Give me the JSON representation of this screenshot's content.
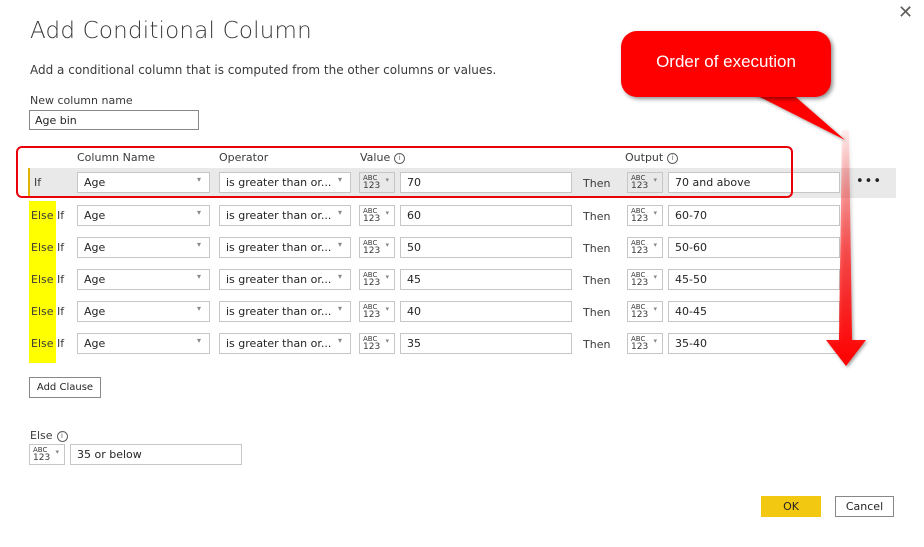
{
  "dialog": {
    "title": "Add Conditional Column",
    "subtitle": "Add a conditional column that is computed from the other columns or values.",
    "close_icon": "close-icon"
  },
  "new_column": {
    "label": "New column name",
    "value": "Age bin"
  },
  "headers": {
    "column_name": "Column Name",
    "operator": "Operator",
    "value": "Value",
    "output": "Output",
    "info_glyph": "i"
  },
  "type_icon": {
    "top": "ABC",
    "bottom": "123",
    "arrow": "▾"
  },
  "dropdown_arrow": "▾",
  "then_label": "Then",
  "more_glyph": "•••",
  "clauses": [
    {
      "prefix": "",
      "keyword": "If",
      "column": "Age",
      "operator": "is greater than or...",
      "value": "70",
      "output": "70 and above"
    },
    {
      "prefix": "Else",
      "keyword": " If",
      "column": "Age",
      "operator": "is greater than or...",
      "value": "60",
      "output": "60-70"
    },
    {
      "prefix": "Else",
      "keyword": " If",
      "column": "Age",
      "operator": "is greater than or...",
      "value": "50",
      "output": "50-60"
    },
    {
      "prefix": "Else",
      "keyword": " If",
      "column": "Age",
      "operator": "is greater than or...",
      "value": "45",
      "output": "45-50"
    },
    {
      "prefix": "Else",
      "keyword": " If",
      "column": "Age",
      "operator": "is greater than or...",
      "value": "40",
      "output": "40-45"
    },
    {
      "prefix": "Else",
      "keyword": " If",
      "column": "Age",
      "operator": "is greater than or...",
      "value": "35",
      "output": "35-40"
    }
  ],
  "add_clause_label": "Add Clause",
  "else_section": {
    "label": "Else",
    "value": "35 or below"
  },
  "buttons": {
    "ok": "OK",
    "cancel": "Cancel"
  },
  "annotation": {
    "callout_text": "Order of execution",
    "color": "#ff0000",
    "highlight_color": "#ffff00"
  }
}
